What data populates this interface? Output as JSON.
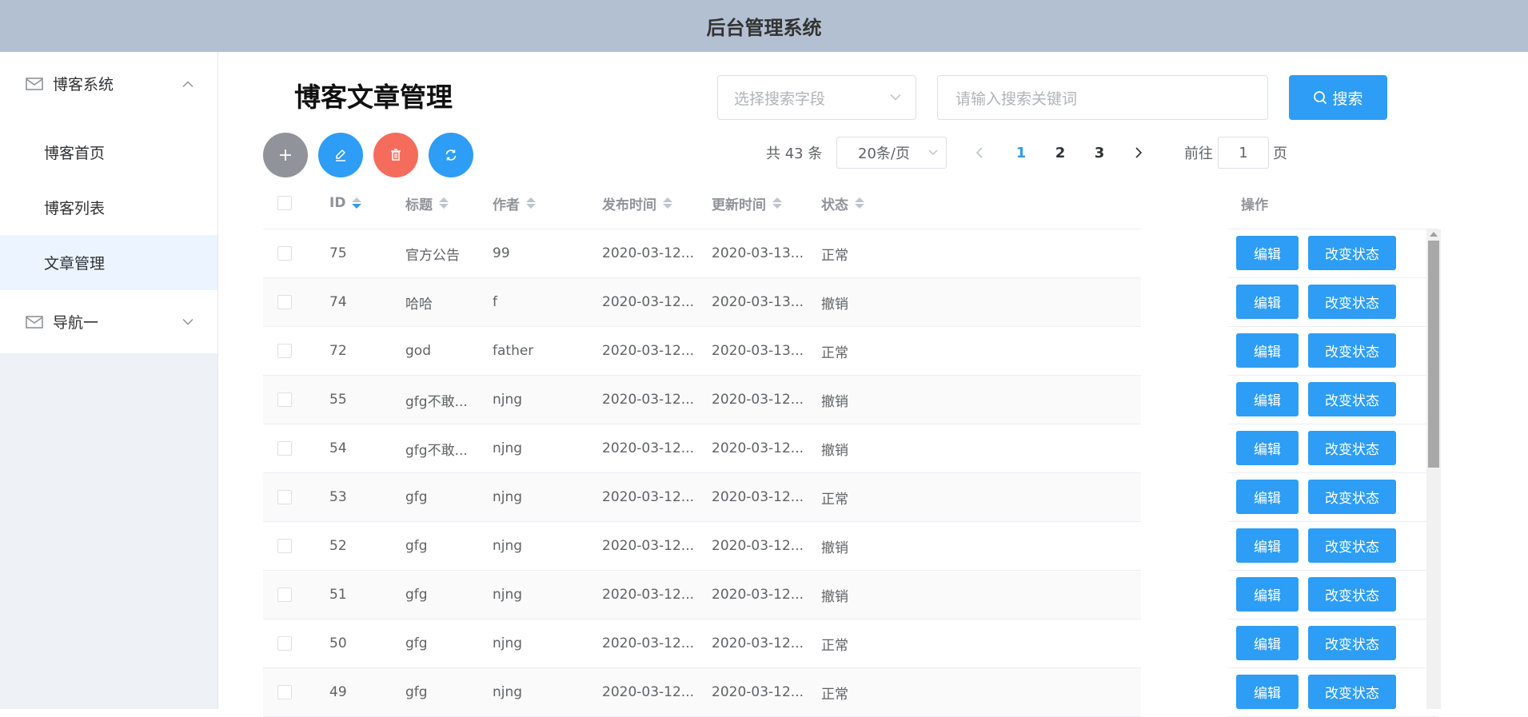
{
  "header": {
    "title": "后台管理系统"
  },
  "sidebar": {
    "groups": [
      {
        "label": "博客系统",
        "icon": "mail-icon",
        "expanded": true,
        "items": [
          {
            "label": "博客首页",
            "active": false
          },
          {
            "label": "博客列表",
            "active": false
          },
          {
            "label": "文章管理",
            "active": true
          }
        ]
      },
      {
        "label": "导航一",
        "icon": "mail-icon",
        "expanded": false,
        "items": []
      }
    ]
  },
  "main": {
    "title": "博客文章管理",
    "search": {
      "field_placeholder": "选择搜索字段",
      "keyword_placeholder": "请输入搜索关键词",
      "button_label": "搜索"
    },
    "actions": [
      {
        "name": "add",
        "icon": "plus-icon",
        "color": "#909399"
      },
      {
        "name": "edit",
        "icon": "edit-icon",
        "color": "#2d9df5"
      },
      {
        "name": "delete",
        "icon": "trash-icon",
        "color": "#f56c5d"
      },
      {
        "name": "refresh",
        "icon": "refresh-icon",
        "color": "#2d9df5"
      }
    ],
    "pagination": {
      "total_label": "共 43 条",
      "page_size": "20条/页",
      "pages": [
        "1",
        "2",
        "3"
      ],
      "current_page": "1",
      "goto_label": "前往",
      "goto_value": "1",
      "goto_suffix": "页"
    },
    "table": {
      "columns": [
        "ID",
        "标题",
        "作者",
        "发布时间",
        "更新时间",
        "状态"
      ],
      "ops_header": "操作",
      "edit_label": "编辑",
      "status_label": "改变状态",
      "rows": [
        {
          "id": "75",
          "title": "官方公告",
          "author": "99",
          "published": "2020-03-12...",
          "updated": "2020-03-13...",
          "status": "正常"
        },
        {
          "id": "74",
          "title": "哈哈",
          "author": "f",
          "published": "2020-03-12...",
          "updated": "2020-03-13...",
          "status": "撤销"
        },
        {
          "id": "72",
          "title": "god",
          "author": "father",
          "published": "2020-03-12...",
          "updated": "2020-03-13...",
          "status": "正常"
        },
        {
          "id": "55",
          "title": "gfg不敢...",
          "author": "njng",
          "published": "2020-03-12...",
          "updated": "2020-03-12...",
          "status": "撤销"
        },
        {
          "id": "54",
          "title": "gfg不敢...",
          "author": "njng",
          "published": "2020-03-12...",
          "updated": "2020-03-12...",
          "status": "撤销"
        },
        {
          "id": "53",
          "title": "gfg",
          "author": "njng",
          "published": "2020-03-12...",
          "updated": "2020-03-12...",
          "status": "正常"
        },
        {
          "id": "52",
          "title": "gfg",
          "author": "njng",
          "published": "2020-03-12...",
          "updated": "2020-03-12...",
          "status": "撤销"
        },
        {
          "id": "51",
          "title": "gfg",
          "author": "njng",
          "published": "2020-03-12...",
          "updated": "2020-03-12...",
          "status": "撤销"
        },
        {
          "id": "50",
          "title": "gfg",
          "author": "njng",
          "published": "2020-03-12...",
          "updated": "2020-03-12...",
          "status": "正常"
        },
        {
          "id": "49",
          "title": "gfg",
          "author": "njng",
          "published": "2020-03-12...",
          "updated": "2020-03-12...",
          "status": "正常"
        }
      ]
    }
  },
  "colors": {
    "primary": "#2d9df5",
    "danger": "#f56c5d",
    "header_bg": "#b3c0d1",
    "active_menu_bg": "#ecf5ff"
  }
}
